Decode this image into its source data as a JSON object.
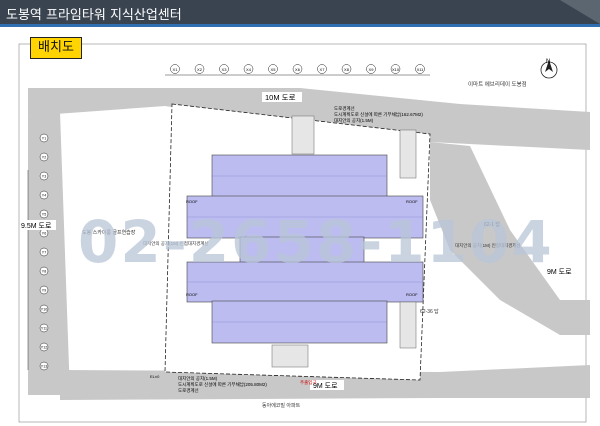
{
  "header": {
    "title": "도봉역 프라임타워 지식산업센터"
  },
  "badge": {
    "label": "배치도"
  },
  "colors": {
    "header_bg": "#3a4450",
    "header_stripe": "#2f6fb2",
    "badge_bg": "#ffd400",
    "road_gray": "#c8c8c8",
    "building_fill": "#bcbcf0",
    "watermark": "#b9c6d8"
  },
  "plan": {
    "bus_stop": "B.S",
    "north_label": "N",
    "apartment_top_right": "이마트 에브리데이 도봉점",
    "grid_top": [
      "X1",
      "X2",
      "X3",
      "X4",
      "X5",
      "X6",
      "X7",
      "X8",
      "X9",
      "X10",
      "X11"
    ],
    "grid_left": [
      "Y1",
      "Y2",
      "Y3",
      "Y4",
      "Y5",
      "Y6",
      "Y7",
      "Y8",
      "Y9",
      "Y10",
      "Y11",
      "Y12",
      "Y13"
    ],
    "road_top": "10M 도로",
    "road_left": "9.5M 도로",
    "road_right": "9M 도로",
    "road_bottom": "9M 도로",
    "lot_right_top": "62-1 답",
    "lot_right_mid": "62-36 답",
    "left_facility": "도봉 스카이룸 골프연습장",
    "building_note_left": "대지안의 공지(1M)\n인접대지경계선",
    "building_note_right": "대지안의 공지(1M)\n인접대지경계선",
    "top_notes": [
      "도로경계선",
      "도시계획도로 신설에 따른 기부채납(162.67M2)",
      "대지안의 공지(1.5M)"
    ],
    "bottom_notes": [
      "대지안의 공지(1.5M)",
      "도시계획도로 신설에 따른 기부채납(205.80M2)",
      "도로경계선"
    ],
    "bottom_building": "동아에코빌 아파트",
    "entrance_label": "주출입구",
    "roof_label": "ROOF",
    "el_label": "EL±0",
    "phone_watermark": "02-2658-1104"
  }
}
